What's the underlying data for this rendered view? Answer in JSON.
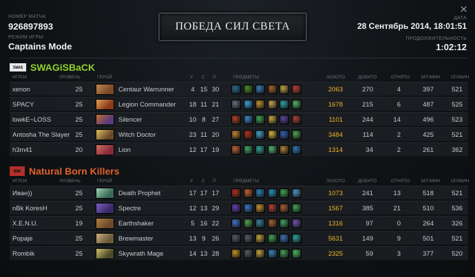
{
  "window": {
    "close_glyph": "×"
  },
  "header": {
    "match_id_label": "НОМЕР МАТЧА",
    "match_id": "926897893",
    "game_mode_label": "РЕЖИМ ИГРЫ",
    "game_mode": "Captains Mode",
    "result": "ПОБЕДА СИЛ СВЕТА",
    "date_label": "ДАТА",
    "date": "28 Сентябрь 2014, 18:01:51",
    "duration_label": "ПРОДОЛЖИТЕЛЬНОСТЬ",
    "duration": "1:02:12"
  },
  "columns": {
    "player": "ИГРОК",
    "level": "УРОВЕНЬ",
    "hero": "ГЕРОЙ",
    "k": "У",
    "d": "С",
    "a": "П",
    "items": "ПРЕДМЕТЫ",
    "gold": "ЗОЛОТО",
    "lh": "ДОБИТО",
    "dn": "ОТНЯТО",
    "xpm": "ЗАТ/МИН",
    "gpm": "ОП/МИН"
  },
  "teams": [
    {
      "name": "SWAGiSBaCK",
      "logo_text": "SWAG",
      "color": "#8fd12b",
      "players": [
        {
          "player": "xenon",
          "level": "25",
          "hero": "Centaur Warrunner",
          "k": "4",
          "d": "15",
          "a": "30",
          "gold": "2063",
          "lh": "270",
          "dn": "4",
          "xpm": "397",
          "gpm": "521",
          "portrait": [
            "#7a4a2a",
            "#c48a52"
          ],
          "items": [
            "#2a6b8a",
            "#4a8a2a",
            "#3c7ab0",
            "#a06030",
            "#c0a040",
            "#b04030"
          ]
        },
        {
          "player": "SPACY",
          "level": "25",
          "hero": "Legion Commander",
          "k": "18",
          "d": "11",
          "a": "21",
          "gold": "1678",
          "lh": "215",
          "dn": "6",
          "xpm": "487",
          "gpm": "525",
          "portrait": [
            "#8a3a1a",
            "#e0a050"
          ],
          "items": [
            "#607080",
            "#3a9ad0",
            "#c09030",
            "#c0a050",
            "#30a0a0",
            "#50b060"
          ]
        },
        {
          "player": "lowkE~LOSS",
          "level": "25",
          "hero": "Silencer",
          "k": "10",
          "d": "8",
          "a": "27",
          "gold": "1101",
          "lh": "244",
          "dn": "14",
          "xpm": "496",
          "gpm": "523",
          "portrait": [
            "#5a3a7a",
            "#c07030"
          ],
          "items": [
            "#b04020",
            "#3a80c0",
            "#40a050",
            "#c0a040",
            "#6040a0",
            "#a04030"
          ]
        },
        {
          "player": "Antosha The Slayer",
          "level": "25",
          "hero": "Witch Doctor",
          "k": "23",
          "d": "11",
          "a": "20",
          "gold": "3484",
          "lh": "114",
          "dn": "2",
          "xpm": "425",
          "gpm": "521",
          "portrait": [
            "#6a4a2a",
            "#e0c060"
          ],
          "items": [
            "#c08030",
            "#b03020",
            "#40a0c0",
            "#d0b040",
            "#3060b0",
            "#50a050"
          ]
        },
        {
          "player": "h3m41",
          "level": "20",
          "hero": "Lion",
          "k": "12",
          "d": "17",
          "a": "19",
          "gold": "1314",
          "lh": "34",
          "dn": "2",
          "xpm": "261",
          "gpm": "362",
          "portrait": [
            "#8a2a3a",
            "#d07060"
          ],
          "items": [
            "#c06030",
            "#40a060",
            "#30a090",
            "#50b070",
            "#b08030",
            "#3070b0"
          ]
        }
      ]
    },
    {
      "name": "Natural Born Killers",
      "logo_text": "NBK",
      "color": "#e0612a",
      "players": [
        {
          "player": "Иван))",
          "level": "25",
          "hero": "Death Prophet",
          "k": "17",
          "d": "17",
          "a": "17",
          "gold": "1073",
          "lh": "241",
          "dn": "13",
          "xpm": "518",
          "gpm": "521",
          "portrait": [
            "#3a6a5a",
            "#a0d0b0"
          ],
          "items": [
            "#b03020",
            "#c06030",
            "#3080b0",
            "#2a8ab0",
            "#40a050",
            "#5090c0"
          ]
        },
        {
          "player": "nBk KoresH",
          "level": "25",
          "hero": "Spectre",
          "k": "12",
          "d": "13",
          "a": "29",
          "gold": "1567",
          "lh": "385",
          "dn": "21",
          "xpm": "510",
          "gpm": "536",
          "portrait": [
            "#3a2a6a",
            "#7a60c0"
          ],
          "items": [
            "#6040b0",
            "#3a70c0",
            "#c09030",
            "#b04030",
            "#a06030",
            "#40a050"
          ]
        },
        {
          "player": "X.E.N.U.",
          "level": "19",
          "hero": "Earthshaker",
          "k": "5",
          "d": "16",
          "a": "22",
          "gold": "1316",
          "lh": "97",
          "dn": "0",
          "xpm": "264",
          "gpm": "326",
          "portrait": [
            "#6a4a2a",
            "#b08040"
          ],
          "items": [
            "#4070c0",
            "#50a050",
            "#3a80a0",
            "#a06030",
            "#40a060",
            "#7050b0"
          ]
        },
        {
          "player": "Popaje",
          "level": "25",
          "hero": "Brewmaster",
          "k": "13",
          "d": "9",
          "a": "26",
          "gold": "5631",
          "lh": "149",
          "dn": "9",
          "xpm": "501",
          "gpm": "521",
          "portrait": [
            "#6a5a3a",
            "#d0b080"
          ],
          "items": [
            "#505860",
            "#505860",
            "#c0a040",
            "#40a050",
            "#3a70b0",
            "#30a0a0"
          ]
        },
        {
          "player": "Rombik",
          "level": "25",
          "hero": "Skywrath Mage",
          "k": "14",
          "d": "13",
          "a": "28",
          "gold": "2325",
          "lh": "59",
          "dn": "3",
          "xpm": "377",
          "gpm": "520",
          "portrait": [
            "#4a4a2a",
            "#d0c070"
          ],
          "items": [
            "#c09020",
            "#505860",
            "#c0a040",
            "#3a80b0",
            "#40a050",
            "#50b060"
          ]
        }
      ]
    }
  ]
}
